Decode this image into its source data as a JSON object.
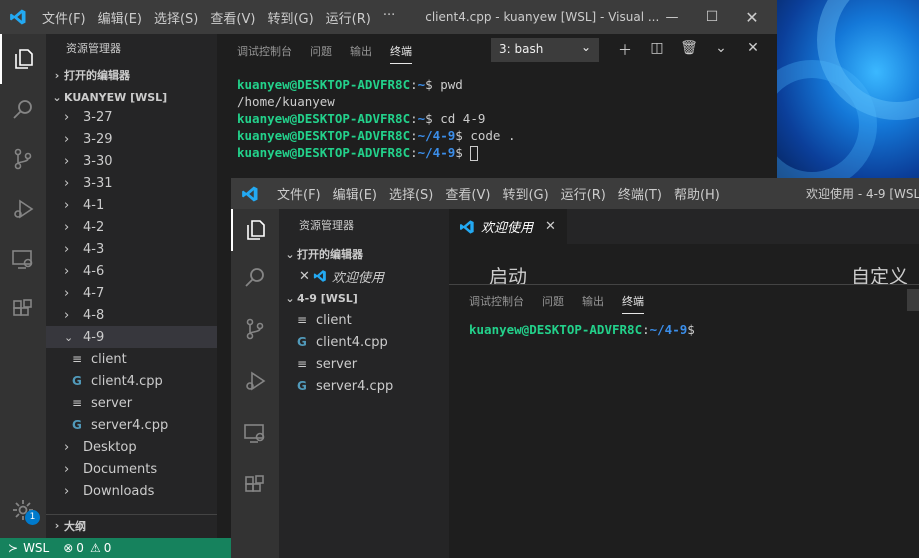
{
  "window1": {
    "title": "client4.cpp - kuanyew [WSL] - Visual ...",
    "menu": [
      "文件(F)",
      "编辑(E)",
      "选择(S)",
      "查看(V)",
      "转到(G)",
      "运行(R)",
      "···"
    ],
    "sidebar": {
      "title": "资源管理器",
      "open_editors": "打开的编辑器",
      "workspace": "KUANYEW [WSL]",
      "items": [
        {
          "label": "3-27",
          "type": "folder"
        },
        {
          "label": "3-29",
          "type": "folder"
        },
        {
          "label": "3-30",
          "type": "folder"
        },
        {
          "label": "3-31",
          "type": "folder"
        },
        {
          "label": "4-1",
          "type": "folder"
        },
        {
          "label": "4-2",
          "type": "folder"
        },
        {
          "label": "4-3",
          "type": "folder"
        },
        {
          "label": "4-6",
          "type": "folder"
        },
        {
          "label": "4-7",
          "type": "folder"
        },
        {
          "label": "4-8",
          "type": "folder"
        },
        {
          "label": "4-9",
          "type": "folder-open"
        }
      ],
      "children": [
        {
          "label": "client",
          "type": "file"
        },
        {
          "label": "client4.cpp",
          "type": "cpp"
        },
        {
          "label": "server",
          "type": "file"
        },
        {
          "label": "server4.cpp",
          "type": "cpp"
        }
      ],
      "after": [
        {
          "label": "Desktop",
          "type": "folder"
        },
        {
          "label": "Documents",
          "type": "folder"
        },
        {
          "label": "Downloads",
          "type": "folder"
        }
      ],
      "outline": "大纲"
    },
    "panel": {
      "tabs": [
        "调试控制台",
        "问题",
        "输出",
        "终端"
      ],
      "terminal_select": "3: bash",
      "lines": [
        {
          "user": "kuanyew@DESKTOP-ADVFR8C",
          "path": "~",
          "cmd": " pwd"
        },
        {
          "output": "/home/kuanyew"
        },
        {
          "user": "kuanyew@DESKTOP-ADVFR8C",
          "path": "~",
          "cmd": " cd 4-9"
        },
        {
          "user": "kuanyew@DESKTOP-ADVFR8C",
          "path": "~/4-9",
          "cmd": " code ."
        },
        {
          "user": "kuanyew@DESKTOP-ADVFR8C",
          "path": "~/4-9",
          "cmd": " "
        }
      ]
    },
    "status": {
      "remote": "WSL",
      "errors": "0",
      "warnings": "0",
      "badge": "1"
    }
  },
  "window2": {
    "title": "欢迎使用 - 4-9 [WSL]",
    "menu": [
      "文件(F)",
      "编辑(E)",
      "选择(S)",
      "查看(V)",
      "转到(G)",
      "运行(R)",
      "终端(T)",
      "帮助(H)"
    ],
    "sidebar": {
      "title": "资源管理器",
      "open_editors": "打开的编辑器",
      "open_editor_item": "欢迎使用",
      "workspace": "4-9 [WSL]",
      "items": [
        {
          "label": "client",
          "type": "file"
        },
        {
          "label": "client4.cpp",
          "type": "cpp"
        },
        {
          "label": "server",
          "type": "file"
        },
        {
          "label": "server4.cpp",
          "type": "cpp"
        }
      ]
    },
    "tab": {
      "label": "欢迎使用"
    },
    "welcome": {
      "start": "启动",
      "customize": "自定义"
    },
    "panel": {
      "tabs": [
        "调试控制台",
        "问题",
        "输出",
        "终端"
      ],
      "line": {
        "user": "kuanyew@DESKTOP-ADVFR8C",
        "path": "~/4-9"
      }
    }
  }
}
